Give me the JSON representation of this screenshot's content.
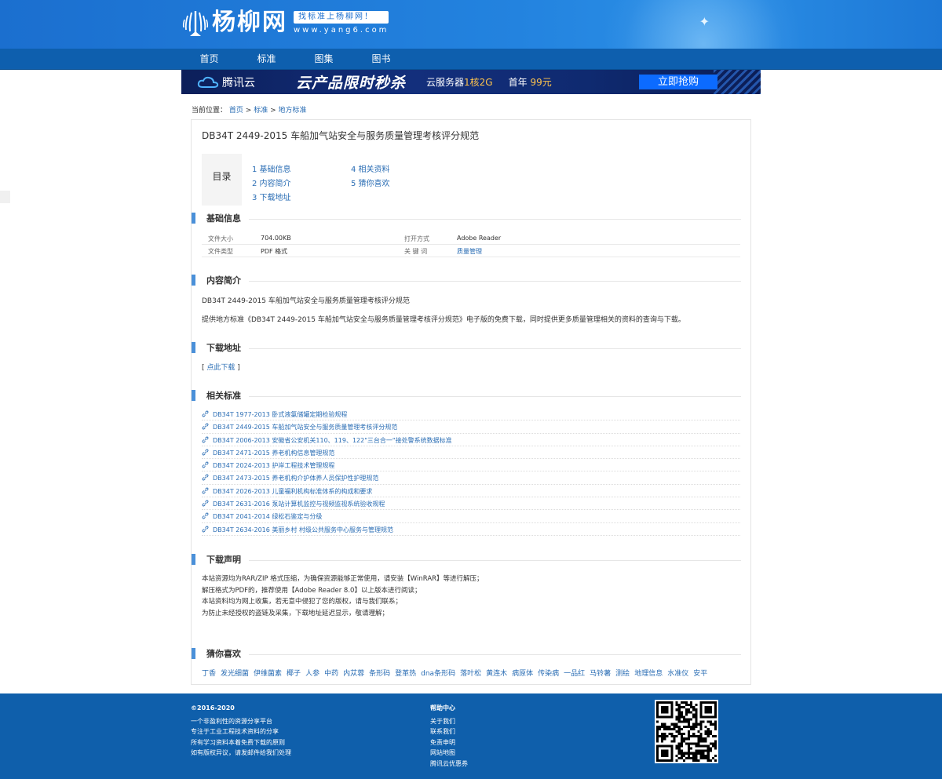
{
  "header": {
    "logo_text": "杨柳网",
    "slogan": "找标准上杨柳网！",
    "domain": "www.yang6.com"
  },
  "nav": [
    {
      "label": "首页"
    },
    {
      "label": "标准"
    },
    {
      "label": "图集"
    },
    {
      "label": "图书"
    }
  ],
  "banner": {
    "brand": "腾讯云",
    "title": "云产品限时秒杀",
    "spec_prefix": "云服务器",
    "spec_highlight": "1核2G",
    "price_prefix": "首年",
    "price_highlight": "99元",
    "button": "立即抢购"
  },
  "breadcrumb": {
    "prefix": "当前位置：",
    "items": [
      "首页",
      "标准",
      "地方标准"
    ],
    "separator": " > "
  },
  "document": {
    "title": "DB34T 2449-2015 车船加气站安全与服务质量管理考核评分规范"
  },
  "toc": {
    "label": "目录",
    "items": [
      "1  基础信息",
      "2  内容简介",
      "3  下载地址",
      "4  相关资料",
      "5  猜你喜欢"
    ]
  },
  "sections": {
    "basic": "基础信息",
    "intro": "内容简介",
    "download": "下载地址",
    "related": "相关标准",
    "declaration": "下载声明",
    "guess": "猜你喜欢"
  },
  "basic_info": {
    "file_size_label": "文件大小",
    "file_size": "704.00KB",
    "open_with_label": "打开方式",
    "open_with": "Adobe Reader",
    "file_type_label": "文件类型",
    "file_type": "PDF 格式",
    "keywords_label": "关 键 词",
    "keywords": "质量管理"
  },
  "intro": {
    "line1": "DB34T 2449-2015 车船加气站安全与服务质量管理考核评分规范",
    "line2": "提供地方标准《DB34T 2449-2015 车船加气站安全与服务质量管理考核评分规范》电子版的免费下载，同时提供更多质量管理相关的资料的查询与下载。"
  },
  "download": {
    "open": "[ ",
    "link": "点此下载",
    "close": " ]"
  },
  "related": [
    "DB34T 1977-2013 卧式液氯储罐定期检验规程",
    "DB34T 2449-2015 车船加气站安全与服务质量管理考核评分规范",
    "DB34T 2006-2013 安徽省公安机关110、119、122\"三台合一\"接处警系统数据标准",
    "DB34T 2471-2015 养老机构信息管理规范",
    "DB34T 2024-2013 护岸工程技术管理规程",
    "DB34T 2473-2015 养老机构介护体养人员保护性护理规范",
    "DB34T 2026-2013 儿童福利机构标准体系的构成和要求",
    "DB34T 2631-2016 泵站计算机监控与视频监视系统验收规程",
    "DB34T 2041-2014 绿松石鉴定与分级",
    "DB34T 2634-2016 美丽乡村 村级公共服务中心服务与管理规范"
  ],
  "declaration": [
    "本站资源均为RAR/ZIP 格式压缩，为确保资源能够正常使用，请安装【WinRAR】等进行解压；",
    "解压格式为PDF的，推荐使用【Adobe Reader 8.0】以上版本进行阅读；",
    "本站资料均为网上收集，若无意中侵犯了您的版权，请与我们联系；",
    "为防止未经授权的盗链及采集，下载地址延迟显示，敬请理解；"
  ],
  "tags": [
    "丁香",
    "发光细菌",
    "伊维菌素",
    "椰子",
    "人参",
    "中药",
    "内苁蓉",
    "条形码",
    "登革热",
    "dna条形码",
    "落叶松",
    "黄连木",
    "病原体",
    "传染病",
    "一品红",
    "马铃薯",
    "测绘",
    "地理信息",
    "水准仪",
    "安平"
  ],
  "footer": {
    "copyright": "©2016-2020",
    "lines": [
      "一个非盈利性的资源分享平台",
      "专注于工业工程技术资料的分享",
      "所有学习资料本着免费下载的原则",
      "如有版权异议，请发邮件给我们处理"
    ],
    "help_title": "帮助中心",
    "help_links": [
      "关于我们",
      "联系我们",
      "免责申明",
      "网站地图",
      "腾讯云优惠券"
    ]
  },
  "colors": {
    "header_blue": "#2383df",
    "nav_blue": "#0e5fae",
    "link_blue": "#2a6db4",
    "section_bar": "#4a90d9",
    "footer_blue": "#0f5fab"
  },
  "icons": {
    "related_item": "link-icon",
    "qr": "qr-code-icon"
  }
}
